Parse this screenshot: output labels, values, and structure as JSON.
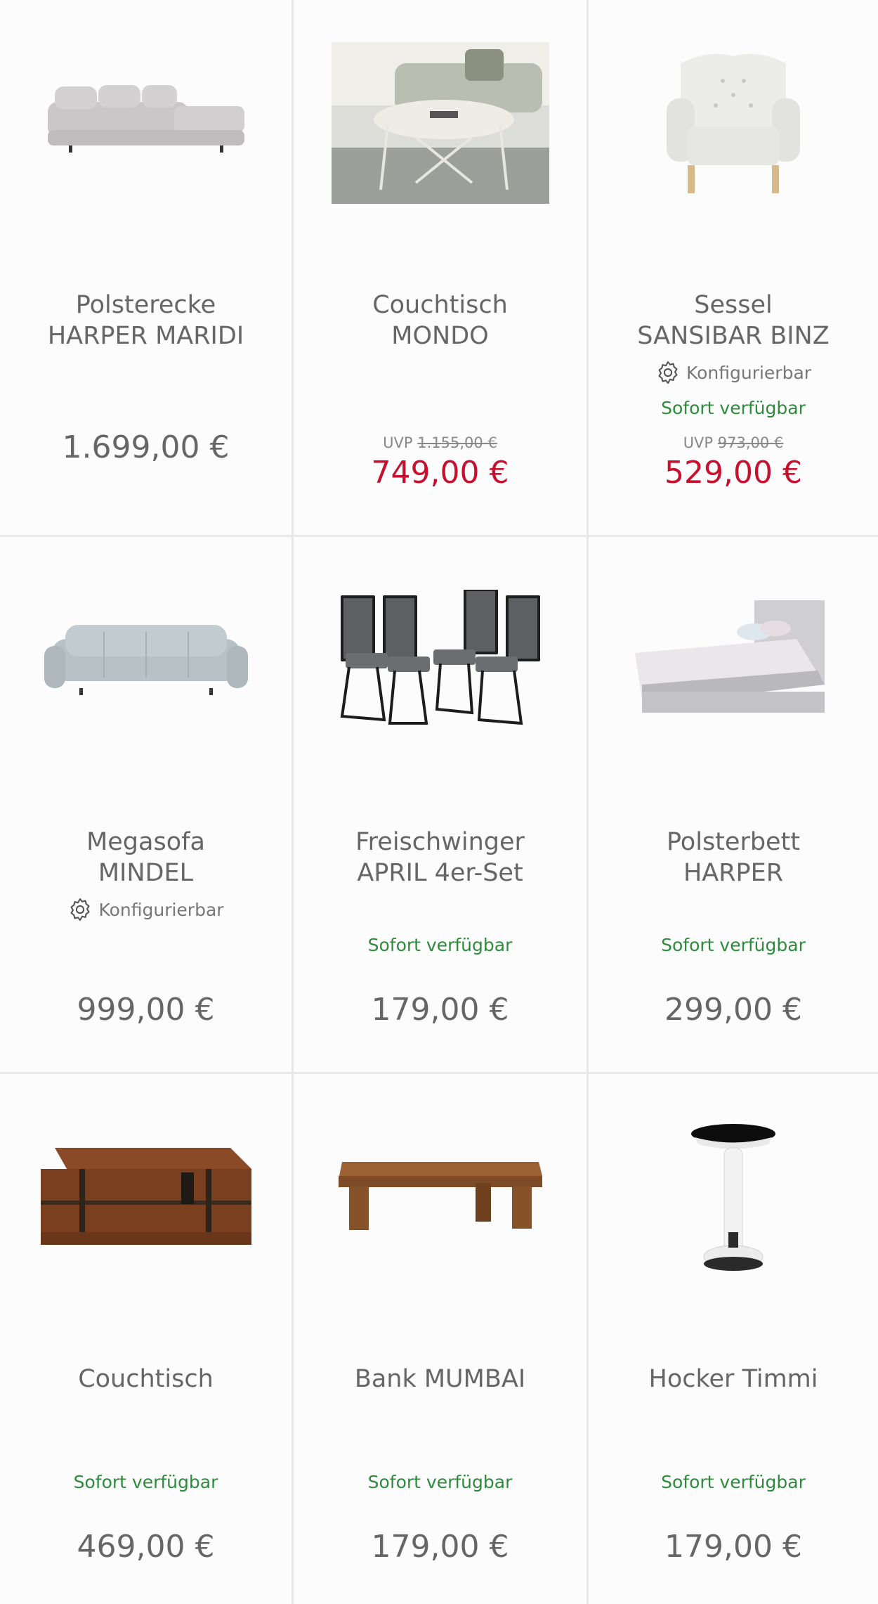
{
  "products": [
    {
      "name": "Polsterecke\nHARPER MARIDI",
      "price": "1.699,00 €",
      "image_icon": "corner-sofa-icon"
    },
    {
      "name": "Couchtisch\nMONDO",
      "uvp_label": "UVP",
      "uvp_price": "1.155,00 €",
      "price": "749,00 €",
      "image_icon": "coffee-table-icon"
    },
    {
      "name": "Sessel\nSANSIBAR BINZ",
      "configurable": "Konfigurierbar",
      "availability": "Sofort verfügbar",
      "uvp_label": "UVP",
      "uvp_price": "973,00 €",
      "price": "529,00 €",
      "image_icon": "armchair-icon"
    },
    {
      "name": "Megasofa\nMINDEL",
      "configurable": "Konfigurierbar",
      "price": "999,00 €",
      "image_icon": "sofa-icon"
    },
    {
      "name": "Freischwinger\nAPRIL 4er-Set",
      "availability": "Sofort verfügbar",
      "price": "179,00 €",
      "image_icon": "chairs-icon"
    },
    {
      "name": "Polsterbett\nHARPER",
      "availability": "Sofort verfügbar",
      "price": "299,00 €",
      "image_icon": "bed-icon"
    },
    {
      "name": "Couchtisch",
      "availability": "Sofort verfügbar",
      "price": "469,00 €",
      "image_icon": "chest-table-icon"
    },
    {
      "name": "Bank MUMBAI",
      "availability": "Sofort verfügbar",
      "price": "179,00 €",
      "image_icon": "bench-icon"
    },
    {
      "name": "Hocker Timmi",
      "availability": "Sofort verfügbar",
      "price": "179,00 €",
      "image_icon": "stool-icon"
    }
  ],
  "colors": {
    "sale": "#c8102e",
    "available": "#2e8b3c",
    "text": "#666666",
    "divider": "#e8e8e8"
  }
}
